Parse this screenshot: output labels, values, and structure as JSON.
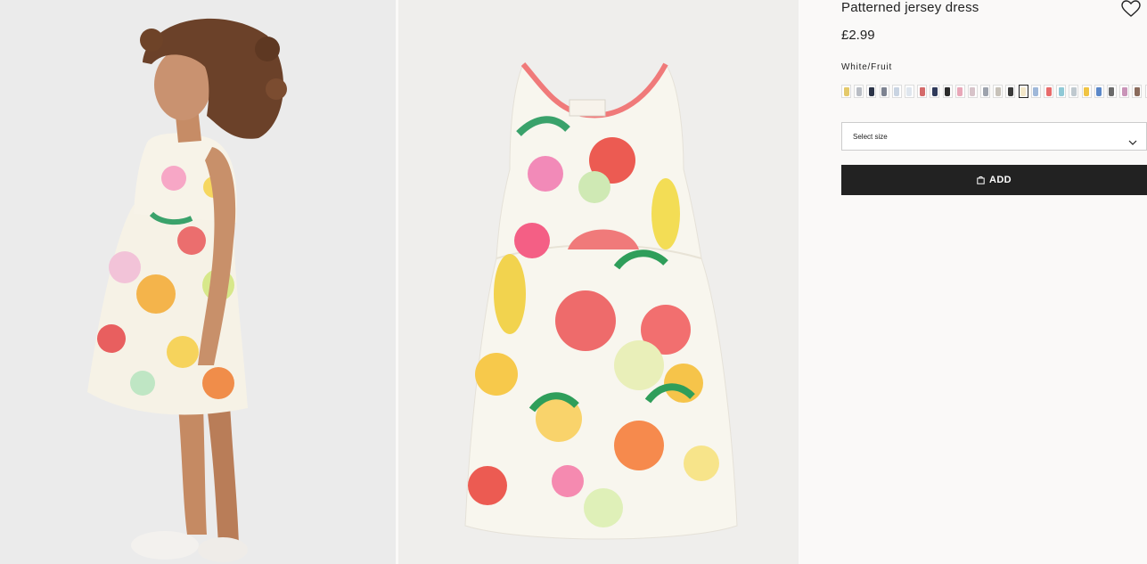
{
  "product": {
    "title": "Patterned jersey dress",
    "price": "£2.99",
    "color_name": "White/Fruit",
    "size_placeholder": "Select size",
    "add_label": "ADD"
  },
  "swatches": [
    {
      "color": "#e4c96a"
    },
    {
      "color": "#b9bdc4"
    },
    {
      "color": "#2c3448"
    },
    {
      "color": "#7d8391"
    },
    {
      "color": "#c9d4e2"
    },
    {
      "color": "#dfe6ee"
    },
    {
      "color": "#d46a6a"
    },
    {
      "color": "#2f3a5a"
    },
    {
      "color": "#2b2b2b"
    },
    {
      "color": "#e8a7b8"
    },
    {
      "color": "#d7c3c9"
    },
    {
      "color": "#9da3ad"
    },
    {
      "color": "#c7c2b9"
    },
    {
      "color": "#3a3a3a"
    },
    {
      "color": "#f2e6c8",
      "selected": true
    },
    {
      "color": "#9fb8d9"
    },
    {
      "color": "#e86b6b"
    },
    {
      "color": "#8fc9d6"
    },
    {
      "color": "#bfc9cf"
    },
    {
      "color": "#f0c443"
    },
    {
      "color": "#5b88c8"
    },
    {
      "color": "#6a6a6a"
    },
    {
      "color": "#c994b8"
    },
    {
      "color": "#8a6b5c"
    },
    {
      "color": "#f0a3b3"
    },
    {
      "color": "#e3b7c0"
    },
    {
      "color": "#e9e9e9"
    },
    {
      "color": "#e34b4b"
    }
  ],
  "icons": {
    "favorite": "heart-outline-icon",
    "size_dropdown": "chevron-down-icon",
    "add": "shopping-bag-icon"
  }
}
